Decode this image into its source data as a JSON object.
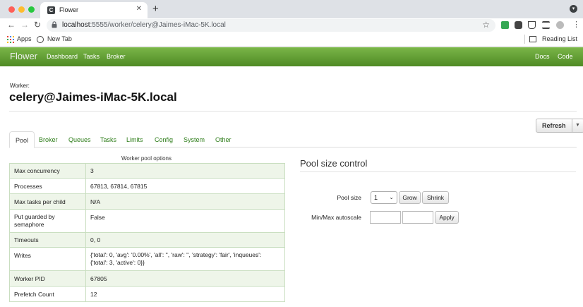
{
  "browser": {
    "tab_title": "Flower",
    "tab_favicon_letter": "C",
    "url_host": "localhost",
    "url_path": ":5555/worker/celery@Jaimes-iMac-5K.local",
    "bookmarks": [
      "Apps",
      "New Tab"
    ],
    "reading_list": "Reading List",
    "icons": [
      "back-icon",
      "forward-icon",
      "reload-icon",
      "lock-icon",
      "star-icon",
      "extension-icon",
      "puzzle-icon",
      "flask-icon",
      "media-icon",
      "profile-icon",
      "menu-icon"
    ]
  },
  "navbar": {
    "brand": "Flower",
    "links": [
      "Dashboard",
      "Tasks",
      "Broker"
    ],
    "right_links": [
      "Docs",
      "Code"
    ],
    "color": "#5e9a32"
  },
  "worker": {
    "label": "Worker:",
    "name": "celery@Jaimes-iMac-5K.local"
  },
  "refresh": {
    "label": "Refresh"
  },
  "tabs": [
    "Pool",
    "Broker",
    "Queues",
    "Tasks",
    "Limits",
    "Config",
    "System",
    "Other"
  ],
  "pool_options": {
    "caption": "Worker pool options",
    "rows": [
      {
        "key": "Max concurrency",
        "value": "3"
      },
      {
        "key": "Processes",
        "value": "67813, 67814, 67815"
      },
      {
        "key": "Max tasks per child",
        "value": "N/A"
      },
      {
        "key": "Put guarded by semaphore",
        "value": "False"
      },
      {
        "key": "Timeouts",
        "value": "0, 0"
      },
      {
        "key": "Writes",
        "value": "{'total': 0, 'avg': '0.00%', 'all': '', 'raw': '', 'strategy': 'fair', 'inqueues': {'total': 3, 'active': 0}}"
      },
      {
        "key": "Worker PID",
        "value": "67805"
      },
      {
        "key": "Prefetch Count",
        "value": "12"
      }
    ]
  },
  "pool_control": {
    "title": "Pool size control",
    "pool_size_label": "Pool size",
    "pool_size_value": "1",
    "grow_label": "Grow",
    "shrink_label": "Shrink",
    "autoscale_label": "Min/Max autoscale",
    "apply_label": "Apply"
  }
}
